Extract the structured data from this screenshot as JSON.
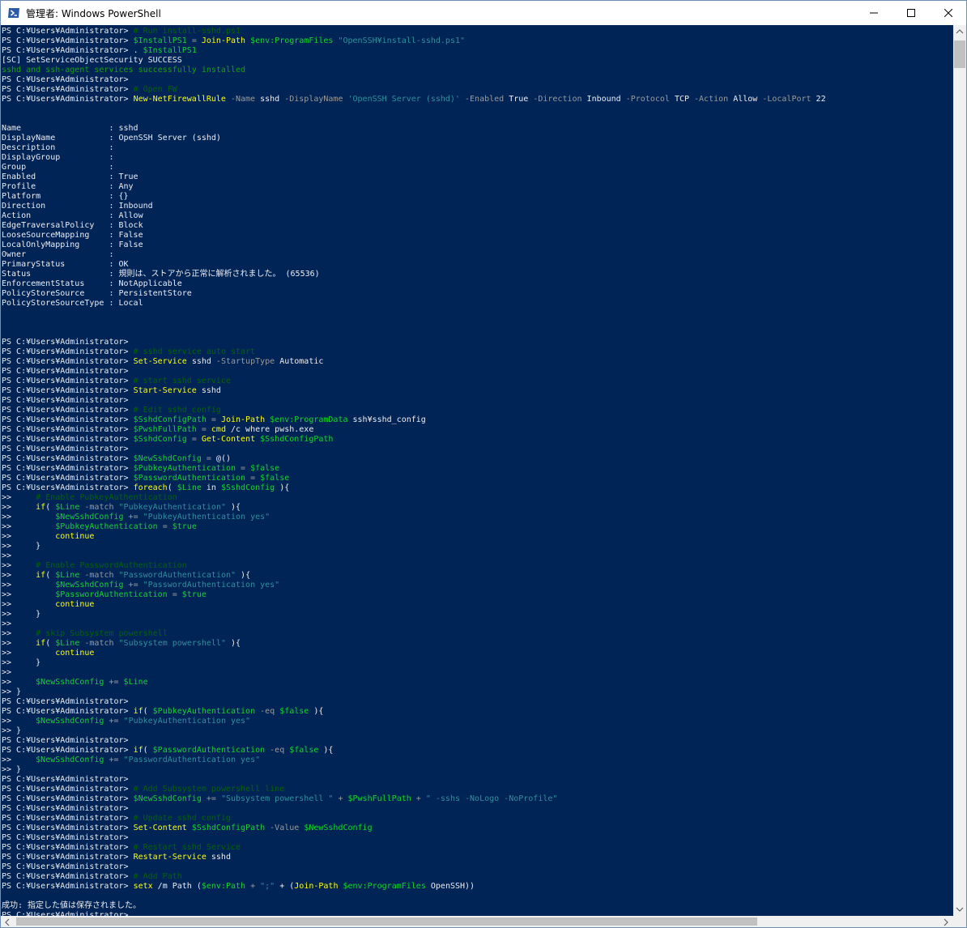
{
  "window": {
    "title": "管理者: Windows PowerShell",
    "controls": {
      "minimize": "minimize-icon",
      "maximize": "maximize-icon",
      "close": "close-icon"
    }
  },
  "colors": {
    "background": "#012456",
    "text": "#eeedf0",
    "command": "#ffff00",
    "comment": "#006400",
    "string": "#2f8f9d",
    "parameter": "#9a9a9a",
    "variable": "#13d42b",
    "success": "#13a10e"
  },
  "console": {
    "lines": [
      [
        {
          "t": "PS C:¥Users¥Administrator> ",
          "c": "w"
        },
        {
          "t": "# Run install-sshd.ps1",
          "c": "c"
        }
      ],
      [
        {
          "t": "PS C:¥Users¥Administrator> ",
          "c": "w"
        },
        {
          "t": "$InstallPS1",
          "c": "v"
        },
        {
          "t": " = ",
          "c": "p"
        },
        {
          "t": "Join-Path",
          "c": "y"
        },
        {
          "t": " ",
          "c": "w"
        },
        {
          "t": "$env:ProgramFiles",
          "c": "v"
        },
        {
          "t": " ",
          "c": "w"
        },
        {
          "t": "\"OpenSSH¥install-sshd.ps1\"",
          "c": "s"
        }
      ],
      [
        {
          "t": "PS C:¥Users¥Administrator> ",
          "c": "w"
        },
        {
          "t": ". ",
          "c": "w"
        },
        {
          "t": "$InstallPS1",
          "c": "v"
        }
      ],
      [
        {
          "t": "[SC] SetServiceObjectSecurity SUCCESS",
          "c": "w"
        }
      ],
      [
        {
          "t": "sshd and ssh-agent services successfully installed",
          "c": "g"
        }
      ],
      [
        {
          "t": "PS C:¥Users¥Administrator>",
          "c": "w"
        }
      ],
      [
        {
          "t": "PS C:¥Users¥Administrator> ",
          "c": "w"
        },
        {
          "t": "# Open FW",
          "c": "c"
        }
      ],
      [
        {
          "t": "PS C:¥Users¥Administrator> ",
          "c": "w"
        },
        {
          "t": "New-NetFirewallRule",
          "c": "y"
        },
        {
          "t": " -Name ",
          "c": "p"
        },
        {
          "t": "sshd",
          "c": "w"
        },
        {
          "t": " -DisplayName ",
          "c": "p"
        },
        {
          "t": "'OpenSSH Server (sshd)'",
          "c": "s"
        },
        {
          "t": " -Enabled ",
          "c": "p"
        },
        {
          "t": "True",
          "c": "w"
        },
        {
          "t": " -Direction ",
          "c": "p"
        },
        {
          "t": "Inbound",
          "c": "w"
        },
        {
          "t": " -Protocol ",
          "c": "p"
        },
        {
          "t": "TCP",
          "c": "w"
        },
        {
          "t": " -Action ",
          "c": "p"
        },
        {
          "t": "Allow",
          "c": "w"
        },
        {
          "t": " -LocalPort ",
          "c": "p"
        },
        {
          "t": "22",
          "c": "w"
        }
      ],
      [],
      [],
      [
        {
          "t": "Name                  : sshd",
          "c": "w"
        }
      ],
      [
        {
          "t": "DisplayName           : OpenSSH Server (sshd)",
          "c": "w"
        }
      ],
      [
        {
          "t": "Description           :",
          "c": "w"
        }
      ],
      [
        {
          "t": "DisplayGroup          :",
          "c": "w"
        }
      ],
      [
        {
          "t": "Group                 :",
          "c": "w"
        }
      ],
      [
        {
          "t": "Enabled               : True",
          "c": "w"
        }
      ],
      [
        {
          "t": "Profile               : Any",
          "c": "w"
        }
      ],
      [
        {
          "t": "Platform              : {}",
          "c": "w"
        }
      ],
      [
        {
          "t": "Direction             : Inbound",
          "c": "w"
        }
      ],
      [
        {
          "t": "Action                : Allow",
          "c": "w"
        }
      ],
      [
        {
          "t": "EdgeTraversalPolicy   : Block",
          "c": "w"
        }
      ],
      [
        {
          "t": "LooseSourceMapping    : False",
          "c": "w"
        }
      ],
      [
        {
          "t": "LocalOnlyMapping      : False",
          "c": "w"
        }
      ],
      [
        {
          "t": "Owner                 :",
          "c": "w"
        }
      ],
      [
        {
          "t": "PrimaryStatus         : OK",
          "c": "w"
        }
      ],
      [
        {
          "t": "Status                : 規則は、ストアから正常に解析されました。 (65536)",
          "c": "w"
        }
      ],
      [
        {
          "t": "EnforcementStatus     : NotApplicable",
          "c": "w"
        }
      ],
      [
        {
          "t": "PolicyStoreSource     : PersistentStore",
          "c": "w"
        }
      ],
      [
        {
          "t": "PolicyStoreSourceType : Local",
          "c": "w"
        }
      ],
      [],
      [],
      [],
      [
        {
          "t": "PS C:¥Users¥Administrator>",
          "c": "w"
        }
      ],
      [
        {
          "t": "PS C:¥Users¥Administrator> ",
          "c": "w"
        },
        {
          "t": "# sshd service auto start",
          "c": "c"
        }
      ],
      [
        {
          "t": "PS C:¥Users¥Administrator> ",
          "c": "w"
        },
        {
          "t": "Set-Service",
          "c": "y"
        },
        {
          "t": " sshd",
          "c": "w"
        },
        {
          "t": " -StartupType ",
          "c": "p"
        },
        {
          "t": "Automatic",
          "c": "w"
        }
      ],
      [
        {
          "t": "PS C:¥Users¥Administrator>",
          "c": "w"
        }
      ],
      [
        {
          "t": "PS C:¥Users¥Administrator> ",
          "c": "w"
        },
        {
          "t": "# start sshd service",
          "c": "c"
        }
      ],
      [
        {
          "t": "PS C:¥Users¥Administrator> ",
          "c": "w"
        },
        {
          "t": "Start-Service",
          "c": "y"
        },
        {
          "t": " sshd",
          "c": "w"
        }
      ],
      [
        {
          "t": "PS C:¥Users¥Administrator>",
          "c": "w"
        }
      ],
      [
        {
          "t": "PS C:¥Users¥Administrator> ",
          "c": "w"
        },
        {
          "t": "# Edit sshd_config",
          "c": "c"
        }
      ],
      [
        {
          "t": "PS C:¥Users¥Administrator> ",
          "c": "w"
        },
        {
          "t": "$SshdConfigPath",
          "c": "v"
        },
        {
          "t": " = ",
          "c": "p"
        },
        {
          "t": "Join-Path",
          "c": "y"
        },
        {
          "t": " ",
          "c": "w"
        },
        {
          "t": "$env:ProgramData",
          "c": "v"
        },
        {
          "t": " ssh¥sshd_config",
          "c": "w"
        }
      ],
      [
        {
          "t": "PS C:¥Users¥Administrator> ",
          "c": "w"
        },
        {
          "t": "$PwshFullPath",
          "c": "v"
        },
        {
          "t": " = ",
          "c": "p"
        },
        {
          "t": "cmd",
          "c": "y"
        },
        {
          "t": " /c where pwsh.exe",
          "c": "w"
        }
      ],
      [
        {
          "t": "PS C:¥Users¥Administrator> ",
          "c": "w"
        },
        {
          "t": "$SshdConfig",
          "c": "v"
        },
        {
          "t": " = ",
          "c": "p"
        },
        {
          "t": "Get-Content",
          "c": "y"
        },
        {
          "t": " ",
          "c": "w"
        },
        {
          "t": "$SshdConfigPath",
          "c": "v"
        }
      ],
      [
        {
          "t": "PS C:¥Users¥Administrator>",
          "c": "w"
        }
      ],
      [
        {
          "t": "PS C:¥Users¥Administrator> ",
          "c": "w"
        },
        {
          "t": "$NewSshdConfig",
          "c": "v"
        },
        {
          "t": " = ",
          "c": "p"
        },
        {
          "t": "@()",
          "c": "w"
        }
      ],
      [
        {
          "t": "PS C:¥Users¥Administrator> ",
          "c": "w"
        },
        {
          "t": "$PubkeyAuthentication",
          "c": "v"
        },
        {
          "t": " = ",
          "c": "p"
        },
        {
          "t": "$false",
          "c": "v"
        }
      ],
      [
        {
          "t": "PS C:¥Users¥Administrator> ",
          "c": "w"
        },
        {
          "t": "$PasswordAuthentication",
          "c": "v"
        },
        {
          "t": " = ",
          "c": "p"
        },
        {
          "t": "$false",
          "c": "v"
        }
      ],
      [
        {
          "t": "PS C:¥Users¥Administrator> ",
          "c": "w"
        },
        {
          "t": "foreach",
          "c": "y"
        },
        {
          "t": "( ",
          "c": "w"
        },
        {
          "t": "$Line",
          "c": "v"
        },
        {
          "t": " in ",
          "c": "w"
        },
        {
          "t": "$SshdConfig",
          "c": "v"
        },
        {
          "t": " ){",
          "c": "w"
        }
      ],
      [
        {
          "t": ">>     ",
          "c": "w"
        },
        {
          "t": "# Enable PubkeyAuthentication",
          "c": "c"
        }
      ],
      [
        {
          "t": ">>     ",
          "c": "w"
        },
        {
          "t": "if",
          "c": "y"
        },
        {
          "t": "( ",
          "c": "w"
        },
        {
          "t": "$Line",
          "c": "v"
        },
        {
          "t": " -match ",
          "c": "p"
        },
        {
          "t": "\"PubkeyAuthentication\"",
          "c": "s"
        },
        {
          "t": " ){",
          "c": "w"
        }
      ],
      [
        {
          "t": ">>         ",
          "c": "w"
        },
        {
          "t": "$NewSshdConfig",
          "c": "v"
        },
        {
          "t": " += ",
          "c": "p"
        },
        {
          "t": "\"PubkeyAuthentication yes\"",
          "c": "s"
        }
      ],
      [
        {
          "t": ">>         ",
          "c": "w"
        },
        {
          "t": "$PubkeyAuthentication",
          "c": "v"
        },
        {
          "t": " = ",
          "c": "p"
        },
        {
          "t": "$true",
          "c": "v"
        }
      ],
      [
        {
          "t": ">>         ",
          "c": "w"
        },
        {
          "t": "continue",
          "c": "y"
        }
      ],
      [
        {
          "t": ">>     }",
          "c": "w"
        }
      ],
      [
        {
          "t": ">>",
          "c": "w"
        }
      ],
      [
        {
          "t": ">>     ",
          "c": "w"
        },
        {
          "t": "# Enable PasswordAuthentication",
          "c": "c"
        }
      ],
      [
        {
          "t": ">>     ",
          "c": "w"
        },
        {
          "t": "if",
          "c": "y"
        },
        {
          "t": "( ",
          "c": "w"
        },
        {
          "t": "$Line",
          "c": "v"
        },
        {
          "t": " -match ",
          "c": "p"
        },
        {
          "t": "\"PasswordAuthentication\"",
          "c": "s"
        },
        {
          "t": " ){",
          "c": "w"
        }
      ],
      [
        {
          "t": ">>         ",
          "c": "w"
        },
        {
          "t": "$NewSshdConfig",
          "c": "v"
        },
        {
          "t": " += ",
          "c": "p"
        },
        {
          "t": "\"PasswordAuthentication yes\"",
          "c": "s"
        }
      ],
      [
        {
          "t": ">>         ",
          "c": "w"
        },
        {
          "t": "$PasswordAuthentication",
          "c": "v"
        },
        {
          "t": " = ",
          "c": "p"
        },
        {
          "t": "$true",
          "c": "v"
        }
      ],
      [
        {
          "t": ">>         ",
          "c": "w"
        },
        {
          "t": "continue",
          "c": "y"
        }
      ],
      [
        {
          "t": ">>     }",
          "c": "w"
        }
      ],
      [
        {
          "t": ">>",
          "c": "w"
        }
      ],
      [
        {
          "t": ">>     ",
          "c": "w"
        },
        {
          "t": "# skip Subsystem powershell",
          "c": "c"
        }
      ],
      [
        {
          "t": ">>     ",
          "c": "w"
        },
        {
          "t": "if",
          "c": "y"
        },
        {
          "t": "( ",
          "c": "w"
        },
        {
          "t": "$Line",
          "c": "v"
        },
        {
          "t": " -match ",
          "c": "p"
        },
        {
          "t": "\"Subsystem powershell\"",
          "c": "s"
        },
        {
          "t": " ){",
          "c": "w"
        }
      ],
      [
        {
          "t": ">>         ",
          "c": "w"
        },
        {
          "t": "continue",
          "c": "y"
        }
      ],
      [
        {
          "t": ">>     }",
          "c": "w"
        }
      ],
      [
        {
          "t": ">>",
          "c": "w"
        }
      ],
      [
        {
          "t": ">>     ",
          "c": "w"
        },
        {
          "t": "$NewSshdConfig",
          "c": "v"
        },
        {
          "t": " += ",
          "c": "p"
        },
        {
          "t": "$Line",
          "c": "v"
        }
      ],
      [
        {
          "t": ">> }",
          "c": "w"
        }
      ],
      [
        {
          "t": "PS C:¥Users¥Administrator>",
          "c": "w"
        }
      ],
      [
        {
          "t": "PS C:¥Users¥Administrator> ",
          "c": "w"
        },
        {
          "t": "if",
          "c": "y"
        },
        {
          "t": "( ",
          "c": "w"
        },
        {
          "t": "$PubkeyAuthentication",
          "c": "v"
        },
        {
          "t": " -eq ",
          "c": "p"
        },
        {
          "t": "$false",
          "c": "v"
        },
        {
          "t": " ){",
          "c": "w"
        }
      ],
      [
        {
          "t": ">>     ",
          "c": "w"
        },
        {
          "t": "$NewSshdConfig",
          "c": "v"
        },
        {
          "t": " += ",
          "c": "p"
        },
        {
          "t": "\"PubkeyAuthentication yes\"",
          "c": "s"
        }
      ],
      [
        {
          "t": ">> }",
          "c": "w"
        }
      ],
      [
        {
          "t": "PS C:¥Users¥Administrator>",
          "c": "w"
        }
      ],
      [
        {
          "t": "PS C:¥Users¥Administrator> ",
          "c": "w"
        },
        {
          "t": "if",
          "c": "y"
        },
        {
          "t": "( ",
          "c": "w"
        },
        {
          "t": "$PasswordAuthentication",
          "c": "v"
        },
        {
          "t": " -eq ",
          "c": "p"
        },
        {
          "t": "$false",
          "c": "v"
        },
        {
          "t": " ){",
          "c": "w"
        }
      ],
      [
        {
          "t": ">>     ",
          "c": "w"
        },
        {
          "t": "$NewSshdConfig",
          "c": "v"
        },
        {
          "t": " += ",
          "c": "p"
        },
        {
          "t": "\"PasswordAuthentication yes\"",
          "c": "s"
        }
      ],
      [
        {
          "t": ">> }",
          "c": "w"
        }
      ],
      [
        {
          "t": "PS C:¥Users¥Administrator>",
          "c": "w"
        }
      ],
      [
        {
          "t": "PS C:¥Users¥Administrator> ",
          "c": "w"
        },
        {
          "t": "# Add Subsystem powershell line",
          "c": "c"
        }
      ],
      [
        {
          "t": "PS C:¥Users¥Administrator> ",
          "c": "w"
        },
        {
          "t": "$NewSshdConfig",
          "c": "v"
        },
        {
          "t": " += ",
          "c": "p"
        },
        {
          "t": "\"Subsystem powershell \"",
          "c": "s"
        },
        {
          "t": " + ",
          "c": "p"
        },
        {
          "t": "$PwshFullPath",
          "c": "v"
        },
        {
          "t": " + ",
          "c": "p"
        },
        {
          "t": "\" -sshs -NoLogo -NoProfile\"",
          "c": "s"
        }
      ],
      [
        {
          "t": "PS C:¥Users¥Administrator>",
          "c": "w"
        }
      ],
      [
        {
          "t": "PS C:¥Users¥Administrator> ",
          "c": "w"
        },
        {
          "t": "# Update sshd_config",
          "c": "c"
        }
      ],
      [
        {
          "t": "PS C:¥Users¥Administrator> ",
          "c": "w"
        },
        {
          "t": "Set-Content",
          "c": "y"
        },
        {
          "t": " ",
          "c": "w"
        },
        {
          "t": "$SshdConfigPath",
          "c": "v"
        },
        {
          "t": " -Value ",
          "c": "p"
        },
        {
          "t": "$NewSshdConfig",
          "c": "v"
        }
      ],
      [
        {
          "t": "PS C:¥Users¥Administrator>",
          "c": "w"
        }
      ],
      [
        {
          "t": "PS C:¥Users¥Administrator> ",
          "c": "w"
        },
        {
          "t": "# Restart sshd Service",
          "c": "c"
        }
      ],
      [
        {
          "t": "PS C:¥Users¥Administrator> ",
          "c": "w"
        },
        {
          "t": "Restart-Service",
          "c": "y"
        },
        {
          "t": " sshd",
          "c": "w"
        }
      ],
      [
        {
          "t": "PS C:¥Users¥Administrator>",
          "c": "w"
        }
      ],
      [
        {
          "t": "PS C:¥Users¥Administrator> ",
          "c": "w"
        },
        {
          "t": "# Add Path",
          "c": "c"
        }
      ],
      [
        {
          "t": "PS C:¥Users¥Administrator> ",
          "c": "w"
        },
        {
          "t": "setx",
          "c": "y"
        },
        {
          "t": " /m Path (",
          "c": "w"
        },
        {
          "t": "$env:Path",
          "c": "v"
        },
        {
          "t": " + ",
          "c": "p"
        },
        {
          "t": "\";\"",
          "c": "s"
        },
        {
          "t": " + (",
          "c": "w"
        },
        {
          "t": "Join-Path",
          "c": "y"
        },
        {
          "t": " ",
          "c": "w"
        },
        {
          "t": "$env:ProgramFiles",
          "c": "v"
        },
        {
          "t": " OpenSSH))",
          "c": "w"
        }
      ],
      [],
      [
        {
          "t": "成功: 指定した値は保存されました。",
          "c": "w"
        }
      ],
      [
        {
          "t": "PS C:¥Users¥Administrator>",
          "c": "w"
        }
      ]
    ]
  },
  "scrollbars": {
    "vertical": {
      "position": 0.0
    },
    "horizontal": {
      "position": 0.0
    }
  }
}
